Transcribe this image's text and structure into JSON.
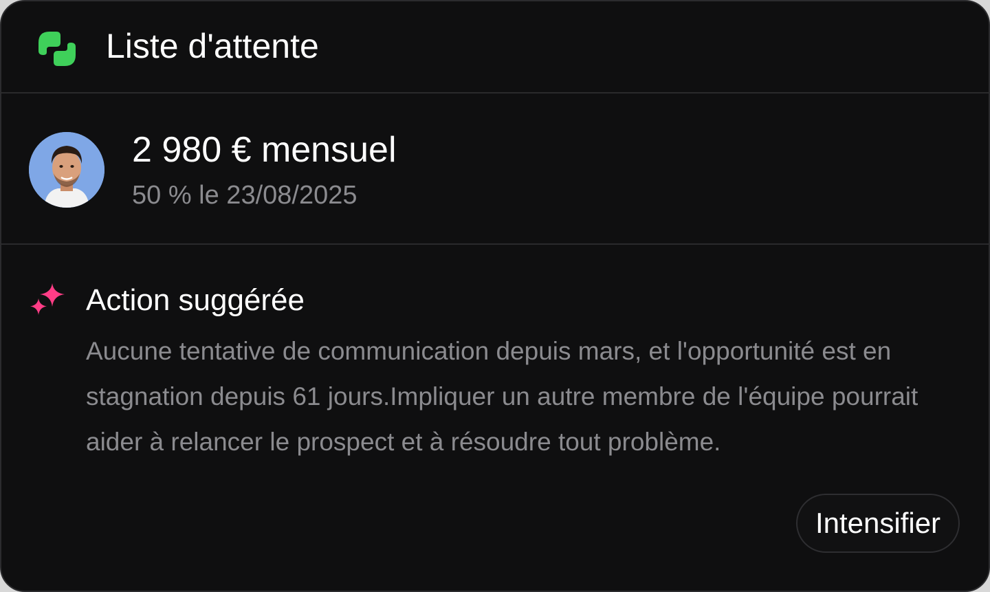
{
  "header": {
    "title": "Liste d'attente",
    "logo_icon": "brand-logo-icon",
    "logo_color": "#3fd05a"
  },
  "deal": {
    "amount": "2 980 € mensuel",
    "detail": "50 % le 23/08/2025",
    "avatar_icon": "person-avatar"
  },
  "suggestion": {
    "icon": "sparkles-icon",
    "icon_color": "#ff3d86",
    "title": "Action suggérée",
    "body": "Aucune tentative de communication depuis mars, et l'opportunité est en stagnation depuis 61 jours.Impliquer un autre membre de l'équipe pourrait aider à relancer le prospect et à résoudre tout problème."
  },
  "actions": {
    "primary_label": "Intensifier"
  },
  "colors": {
    "background": "#0f0f10",
    "text_primary": "#ffffff",
    "text_secondary": "#8b8b8f"
  }
}
